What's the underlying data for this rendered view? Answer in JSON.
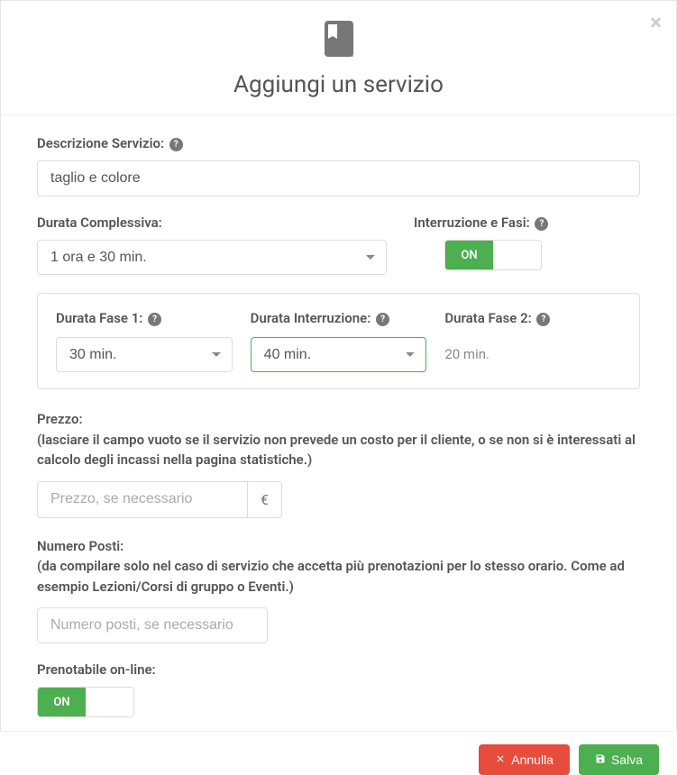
{
  "modal": {
    "title": "Aggiungi un servizio",
    "close_symbol": "×"
  },
  "description": {
    "label": "Descrizione Servizio:",
    "value": "taglio e colore"
  },
  "duration": {
    "label": "Durata Complessiva:",
    "value": "1 ora e 30 min."
  },
  "interruption": {
    "label": "Interruzione e Fasi:",
    "toggle": "ON"
  },
  "phase1": {
    "label": "Durata Fase 1:",
    "value": "30 min."
  },
  "interruption_duration": {
    "label": "Durata Interruzione:",
    "value": "40 min."
  },
  "phase2": {
    "label": "Durata Fase 2:",
    "value": "20 min."
  },
  "price": {
    "label": "Prezzo:",
    "note": "(lasciare il campo vuoto se il servizio non prevede un costo per il cliente, o se non si è interessati al calcolo degli incassi nella pagina statistiche.)",
    "placeholder": "Prezzo, se necessario",
    "currency": "€"
  },
  "seats": {
    "label": "Numero Posti:",
    "note": "(da compilare solo nel caso di servizio che accetta più prenotazioni per lo stesso orario. Come ad esempio Lezioni/Corsi di gruppo o Eventi.)",
    "placeholder": "Numero posti, se necessario"
  },
  "bookable": {
    "label": "Prenotabile on-line:",
    "toggle": "ON"
  },
  "footer": {
    "cancel": "Annulla",
    "save": "Salva"
  },
  "help_symbol": "?"
}
